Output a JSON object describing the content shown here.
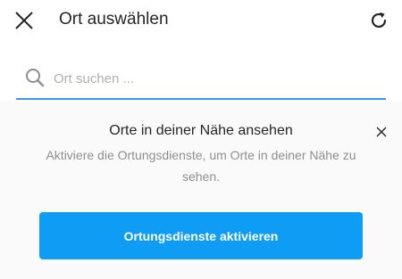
{
  "header": {
    "title": "Ort auswählen",
    "close_icon": "close-icon",
    "refresh_icon": "refresh-icon"
  },
  "search": {
    "placeholder": "Ort suchen ...",
    "value": "",
    "icon": "search-icon",
    "accent_color": "#3897f0"
  },
  "location_banner": {
    "title": "Orte in deiner Nähe ansehen",
    "description": "Aktiviere die Ortungsdienste, um Orte in deiner Nähe zu sehen.",
    "close_icon": "close-icon",
    "button_label": "Ortungsdienste aktivieren",
    "button_color": "#0f9cf5"
  }
}
